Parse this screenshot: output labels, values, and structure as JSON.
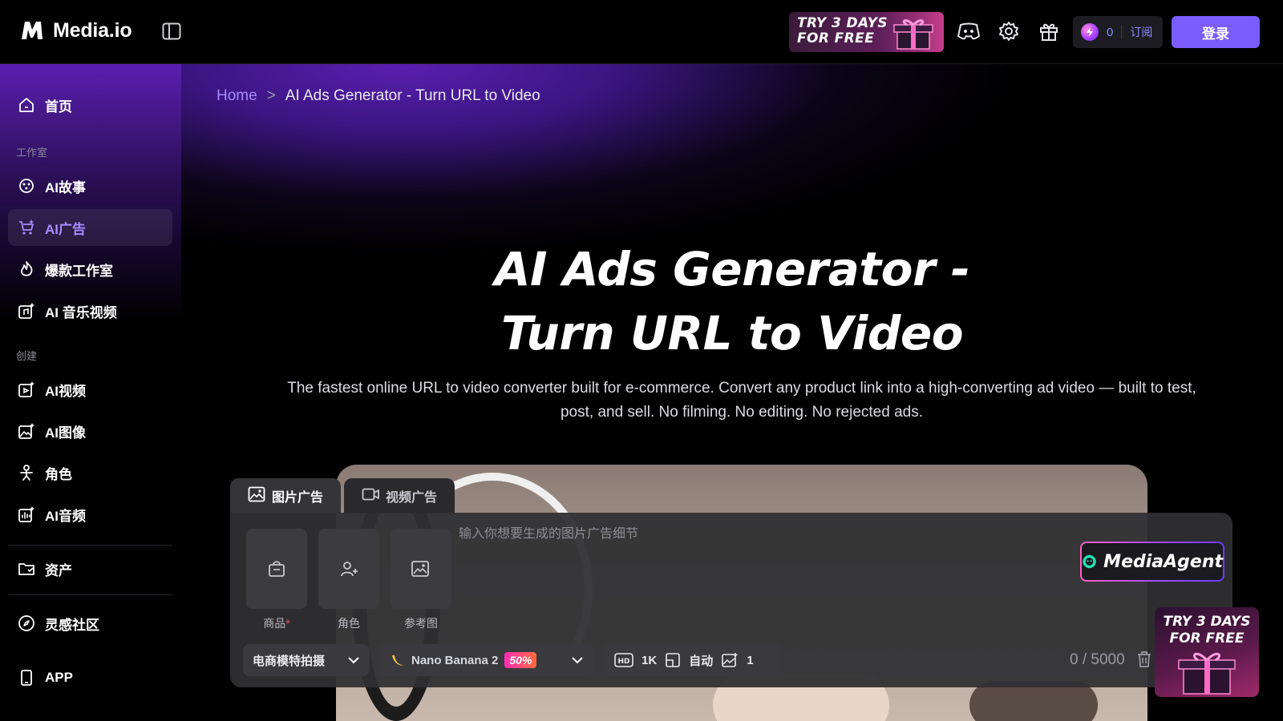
{
  "app": {
    "name": "Media.io"
  },
  "header": {
    "promo_text": "TRY 3 DAYS\nFOR FREE",
    "credits": "0",
    "subscribe_label": "订阅",
    "login_label": "登录",
    "icons": [
      "discord-icon",
      "gear-icon",
      "gift-icon"
    ]
  },
  "sidebar": {
    "home": "首页",
    "section_studio": "工作室",
    "studio_items": [
      {
        "label": "AI故事",
        "icon": "story-icon"
      },
      {
        "label": "AI广告",
        "icon": "ads-cart-icon",
        "active": true
      },
      {
        "label": "爆款工作室",
        "icon": "viral-icon"
      },
      {
        "label": "AI 音乐视频",
        "icon": "music-video-icon"
      }
    ],
    "section_create": "创建",
    "create_items": [
      {
        "label": "AI视频",
        "icon": "video-icon"
      },
      {
        "label": "AI图像",
        "icon": "image-icon"
      },
      {
        "label": "角色",
        "icon": "character-icon"
      },
      {
        "label": "AI音频",
        "icon": "audio-icon"
      }
    ],
    "assets": "资产",
    "community": "灵感社区",
    "app": "APP"
  },
  "breadcrumb": {
    "home": "Home",
    "separator": ">",
    "current": "AI Ads Generator - Turn URL to Video"
  },
  "hero": {
    "title_line1": "AI Ads Generator -",
    "title_line2": "Turn URL to Video",
    "description": "The fastest online URL to video converter built for e-commerce. Convert any product link into a high-converting ad video — built to test, post, and sell. No filming. No editing. No rejected ads."
  },
  "composer": {
    "tabs": [
      {
        "label": "图片广告",
        "active": true
      },
      {
        "label": "视频广告",
        "active": false
      }
    ],
    "assets": [
      {
        "label": "商品",
        "required": "*",
        "icon": "shopping-bag-icon"
      },
      {
        "label": "角色",
        "required": "",
        "icon": "user-add-icon"
      },
      {
        "label": "参考图",
        "required": "",
        "icon": "reference-image-icon"
      }
    ],
    "prompt_placeholder": "输入你想要生成的图片广告细节",
    "agent_label": "MediaAgent",
    "mode_label": "电商模特拍摄",
    "model_label": "Nano Banana 2",
    "model_discount": "50%",
    "resolution": "1K",
    "aspect": "自动",
    "count": "1",
    "char_counter": "0 / 5000"
  },
  "colors": {
    "accent": "#7a5cff",
    "active_nav_text": "#a98bff",
    "breadcrumb_link": "#a78bff",
    "hero_glow": "#5a1fb0"
  }
}
